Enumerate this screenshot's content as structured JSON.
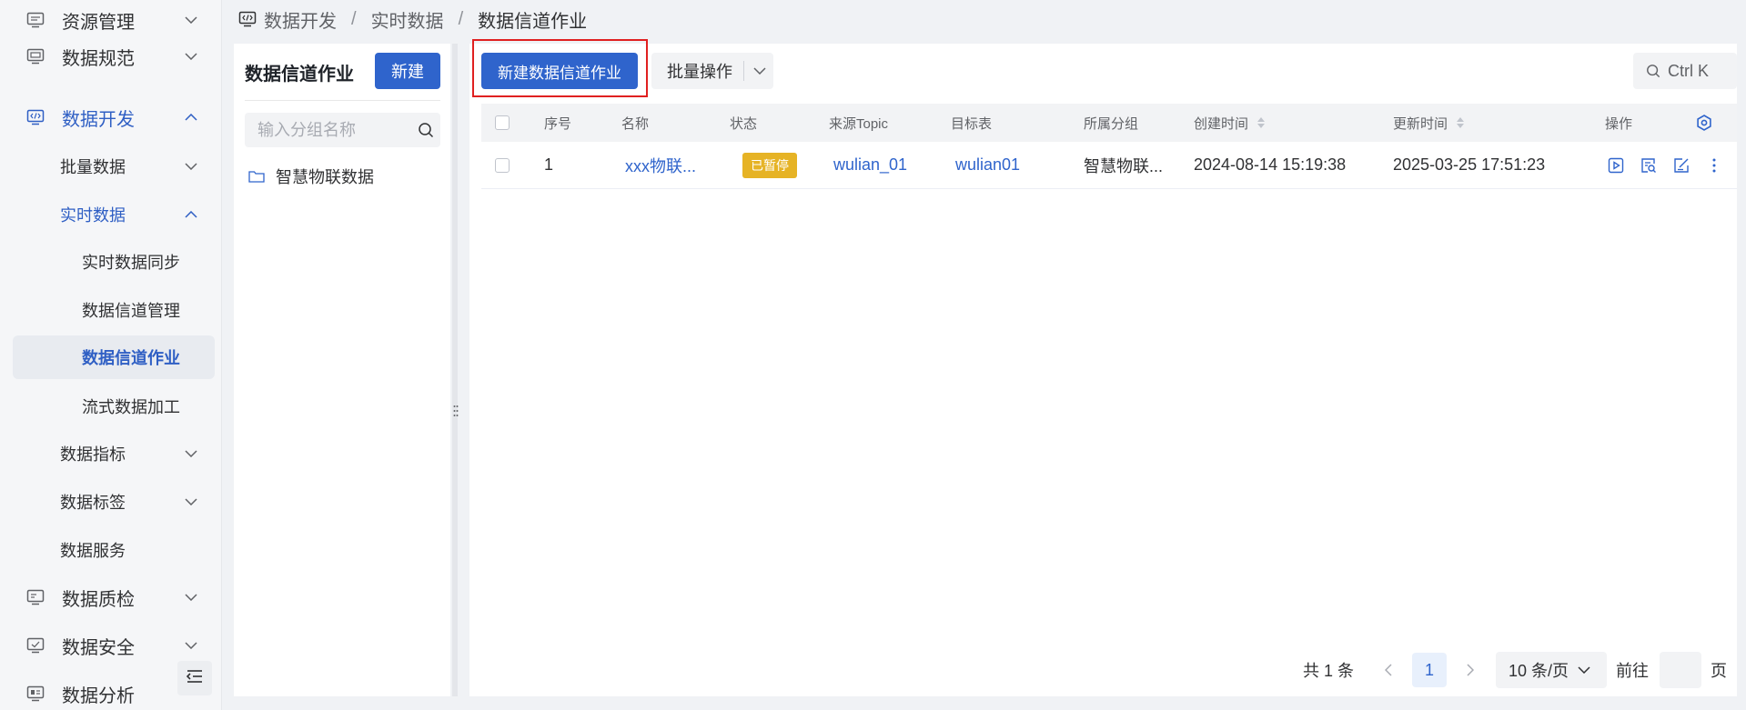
{
  "sidebar": {
    "items": [
      {
        "label": "资源管理",
        "icon": "resource-icon"
      },
      {
        "label": "数据规范",
        "icon": "spec-icon"
      },
      {
        "label": "数据开发",
        "icon": "code-icon"
      },
      {
        "label": "批量数据"
      },
      {
        "label": "实时数据"
      },
      {
        "label": "实时数据同步"
      },
      {
        "label": "数据信道管理"
      },
      {
        "label": "数据信道作业"
      },
      {
        "label": "流式数据加工"
      },
      {
        "label": "数据指标"
      },
      {
        "label": "数据标签"
      },
      {
        "label": "数据服务"
      },
      {
        "label": "数据质检",
        "icon": "quality-icon"
      },
      {
        "label": "数据安全",
        "icon": "security-icon"
      },
      {
        "label": "数据分析",
        "icon": "analysis-icon"
      }
    ]
  },
  "breadcrumb": {
    "items": [
      "数据开发",
      "实时数据",
      "数据信道作业"
    ],
    "separator": "/"
  },
  "group_panel": {
    "title": "数据信道作业",
    "new_label": "新建",
    "search_placeholder": "输入分组名称",
    "nodes": [
      "智慧物联数据"
    ]
  },
  "toolbar": {
    "primary_label": "新建数据信道作业",
    "batch_label": "批量操作",
    "search_label": "Ctrl K"
  },
  "table": {
    "headers": {
      "index": "序号",
      "name": "名称",
      "status": "状态",
      "source": "来源Topic",
      "target": "目标表",
      "group": "所属分组",
      "created": "创建时间",
      "updated": "更新时间",
      "ops": "操作"
    },
    "rows": [
      {
        "index": "1",
        "name": "xxx物联...",
        "status": "已暂停",
        "source": "wulian_01",
        "target": "wulian01",
        "group": "智慧物联...",
        "created": "2024-08-14 15:19:38",
        "updated": "2025-03-25 17:51:23"
      }
    ]
  },
  "pagination": {
    "total": "共 1 条",
    "current_page": "1",
    "page_size": "10 条/页",
    "goto_prefix": "前往",
    "goto_suffix": "页"
  },
  "colors": {
    "primary": "#2f64cc",
    "highlight": "#e02020",
    "status_paused": "#e6b325"
  }
}
